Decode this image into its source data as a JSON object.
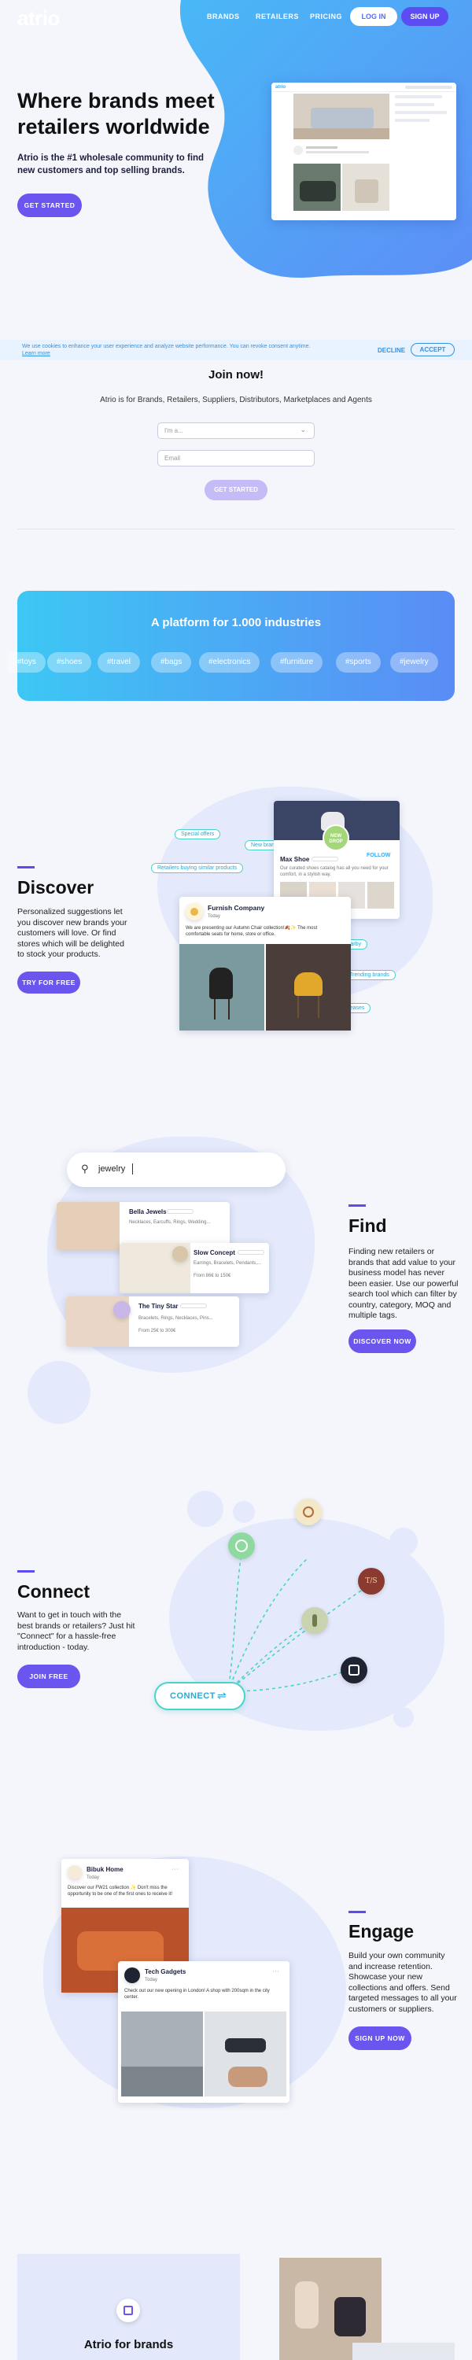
{
  "colors": {
    "accent": "#5c4cf2",
    "blue": "#3aa6f4",
    "teal": "#4ad3c9",
    "bg": "#f5f6fc"
  },
  "header": {
    "logo": "atrio",
    "nav": [
      "BRANDS",
      "RETAILERS",
      "PRICING"
    ],
    "login": "LOG IN",
    "signup": "SIGN UP"
  },
  "hero": {
    "title": "Where brands meet retailers worldwide",
    "subtitle": "Atrio is the #1 wholesale community to find new customers and top selling brands.",
    "cta": "GET STARTED"
  },
  "cookie": {
    "text": "We use cookies to enhance your user experience and analyze website performance. You can revoke consent anytime.",
    "link": "Learn more",
    "decline": "DECLINE",
    "accept": "ACCEPT"
  },
  "join": {
    "title": "Join now!",
    "subtitle": "Atrio is for Brands, Retailers, Suppliers, Distributors, Marketplaces and Agents",
    "select_placeholder": "I'm a...",
    "email_placeholder": "Email",
    "cta": "GET STARTED"
  },
  "platform": {
    "title": "A platform for 1.000 industries",
    "tags": [
      "#toys",
      "#shoes",
      "#travel",
      "#bags",
      "#electronics",
      "#furniture",
      "#sports",
      "#jewelry"
    ]
  },
  "discover": {
    "title": "Discover",
    "text": "Personalized suggestions let you discover new brands your customers will love. Or find stores which will be delighted to stock your products.",
    "cta": "TRY FOR FREE",
    "chips": [
      "Special offers",
      "Retailers buying similar products",
      "New brands",
      "Retailers nearby",
      "Trending brands",
      "New releases"
    ],
    "post": {
      "company": "Furnish Company",
      "time": "Today",
      "text": "We are presenting our Autumn Chair collection!🍂✨ The most comfortable seats for home, store or office."
    },
    "shoe": {
      "name": "Max Shoe",
      "text": "Our curated shoes catalog has all you need for your comfort, in a stylish way.",
      "follow": "FOLLOW",
      "badge": "NEW DROP"
    }
  },
  "find": {
    "title": "Find",
    "text": "Finding new retailers or brands that add value to your business model has never been easier. Use our powerful search tool which can filter by country, category, MOQ and multiple tags.",
    "cta": "DISCOVER NOW",
    "search_value": "jewelry",
    "results": [
      {
        "name": "Bella Jewels",
        "tags": "Necklaces, Earcuffs, Rings, Wedding...",
        "moq": ""
      },
      {
        "name": "Slow Concept",
        "tags": "Earrings, Bracelets, Pendants,...",
        "moq": "From 86€ to 150€"
      },
      {
        "name": "The Tiny Star",
        "tags": "Bracelets, Rings, Necklaces, Pins...",
        "moq": "From 25€ to 300€"
      }
    ]
  },
  "connect": {
    "title": "Connect",
    "text": "Want to get in touch with the best brands or retailers? Just hit \"Connect\" for a hassle-free introduction - today.",
    "cta": "JOIN FREE",
    "button": "CONNECT"
  },
  "engage": {
    "title": "Engage",
    "text": "Build your own community and increase retention. Showcase your new collections and offers. Send targeted messages to all your customers or suppliers.",
    "cta": "SIGN UP NOW",
    "post1": {
      "name": "Bibuk Home",
      "time": "Today",
      "text": "Discover our FW21 collection ✨ Don't miss the opportunity to be one of the first ones to receive it!"
    },
    "post2": {
      "name": "Tech Gadgets",
      "time": "Today",
      "text": "Check out our new opening in London! A shop with 200sqm in the city center."
    }
  },
  "footer": {
    "title": "Atrio for brands"
  }
}
